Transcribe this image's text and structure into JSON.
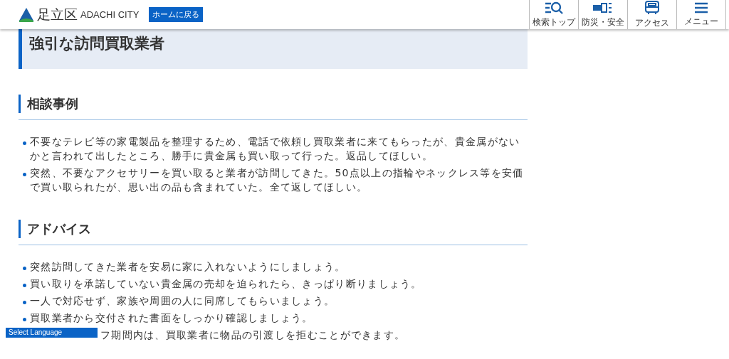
{
  "header": {
    "logo_text": "足立区",
    "logo_subtext": "ADACHI CITY",
    "home_button": "ホームに戻る",
    "nav": [
      {
        "kind": "search",
        "label": "検索トップ"
      },
      {
        "kind": "disaster",
        "label": "防災・安全"
      },
      {
        "kind": "access",
        "label": "アクセス"
      },
      {
        "kind": "menu",
        "label": "メニュー"
      }
    ]
  },
  "page_title": "強引な訪問買取業者",
  "sections": [
    {
      "heading": "相談事例",
      "items": [
        "不要なテレビ等の家電製品を整理するため、電話で依頼し買取業者に来てもらったが、貴金属がないかと言われて出したところ、勝手に貴金属も買い取って行った。返品してほしい。",
        "突然、不要なアクセサリーを買い取ると業者が訪問してきた。50点以上の指輪やネックレス等を安価で買い取られたが、思い出の品も含まれていた。全て返してほしい。"
      ]
    },
    {
      "heading": "アドバイス",
      "items": [
        "突然訪問してきた業者を安易に家に入れないようにしましょう。",
        "買い取りを承諾していない貴金属の売却を迫られたら、きっぱり断りましょう。",
        "一人で対応せず、家族や周囲の人に同席してもらいましょう。",
        "買取業者から交付された書面をしっかり確認しましょう。",
        "フ期間内は、買取業者に物品の引渡しを拒むことができます。"
      ]
    }
  ],
  "language_select": "Select Language"
}
